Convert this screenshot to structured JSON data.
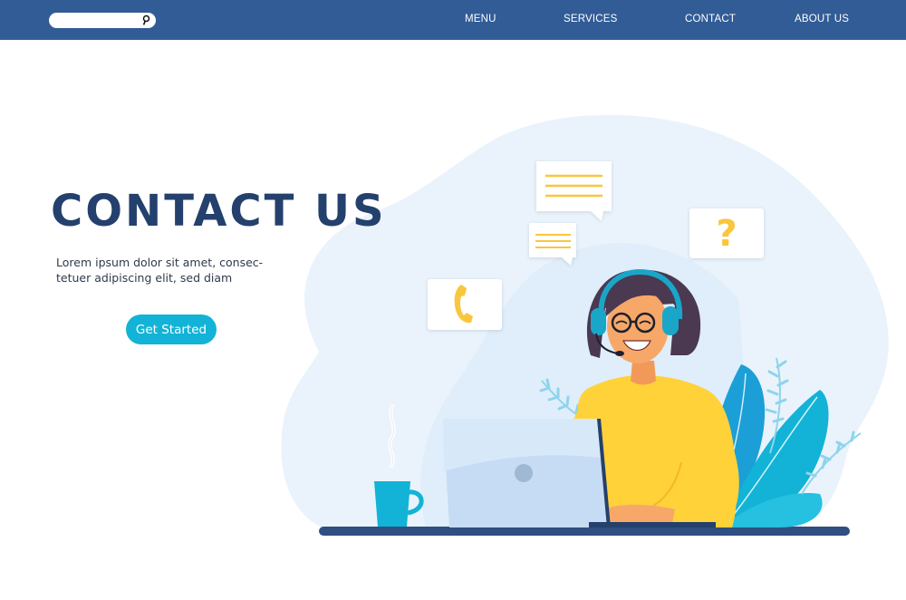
{
  "nav": {
    "search_placeholder": "",
    "items": [
      {
        "label": "MENU"
      },
      {
        "label": "SERVICES"
      },
      {
        "label": "CONTACT"
      },
      {
        "label": "ABOUT US"
      }
    ]
  },
  "hero": {
    "title": "CONTACT US",
    "subtitle_line1": "Lorem ipsum dolor sit amet, consec-",
    "subtitle_line2": "tetuer adipiscing elit, sed diam",
    "cta_label": "Get Started"
  },
  "bubbles": {
    "question_mark": "?"
  },
  "colors": {
    "navbar": "#325c96",
    "title": "#24406d",
    "accent_cyan": "#12b3d6",
    "yellow": "#f9c63d",
    "blob": "#eaf3fc",
    "desk": "#2e4f80"
  }
}
